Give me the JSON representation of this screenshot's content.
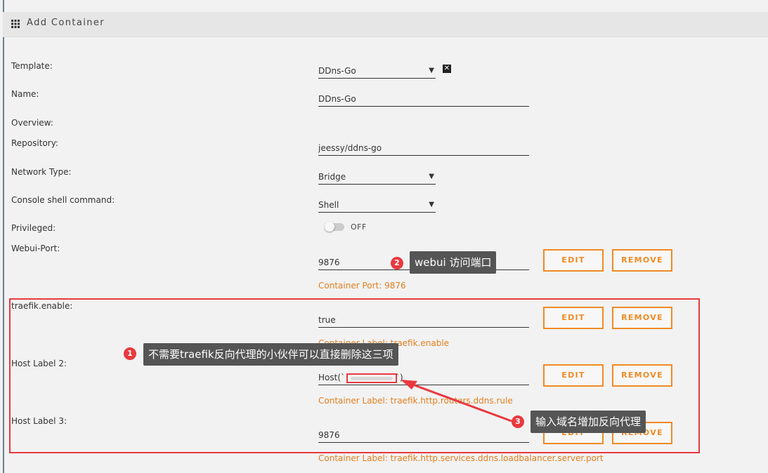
{
  "header": {
    "title": "Add Container",
    "icon": "grid-icon"
  },
  "form": {
    "template": {
      "label": "Template:",
      "value": "DDns-Go"
    },
    "name": {
      "label": "Name:",
      "value": "DDns-Go"
    },
    "overview": {
      "label": "Overview:"
    },
    "repository": {
      "label": "Repository:",
      "value": "jeessy/ddns-go"
    },
    "network_type": {
      "label": "Network Type:",
      "value": "Bridge"
    },
    "console_shell": {
      "label": "Console shell command:",
      "value": "Shell"
    },
    "privileged": {
      "label": "Privileged:",
      "state": "OFF"
    },
    "webui_port": {
      "label": "Webui-Port:",
      "value": "9876",
      "hint": "Container Port: 9876"
    },
    "traefik_enable": {
      "label": "traefik.enable:",
      "value": "true",
      "hint": "Container Label: traefik.enable"
    },
    "host_label_2": {
      "label": "Host Label 2:",
      "value_prefix": "Host(`",
      "value_suffix": "`)",
      "hint": "Container Label: traefik.http.routers.ddns.rule"
    },
    "host_label_3": {
      "label": "Host Label 3:",
      "value": "9876",
      "hint": "Container Label: traefik.http.services.ddns.loadbalancer.server.port"
    }
  },
  "buttons": {
    "edit": "EDIT",
    "remove": "REMOVE"
  },
  "annotations": {
    "one": {
      "num": "1",
      "text": "不需要traefik反向代理的小伙伴可以直接删除这三项"
    },
    "two": {
      "num": "2",
      "text": "webui 访问端口"
    },
    "three": {
      "num": "3",
      "text": "输入域名增加反向代理"
    }
  },
  "colors": {
    "accent": "#f08a24",
    "annotation_red": "#e8393f",
    "callout_bg": "#555555"
  }
}
